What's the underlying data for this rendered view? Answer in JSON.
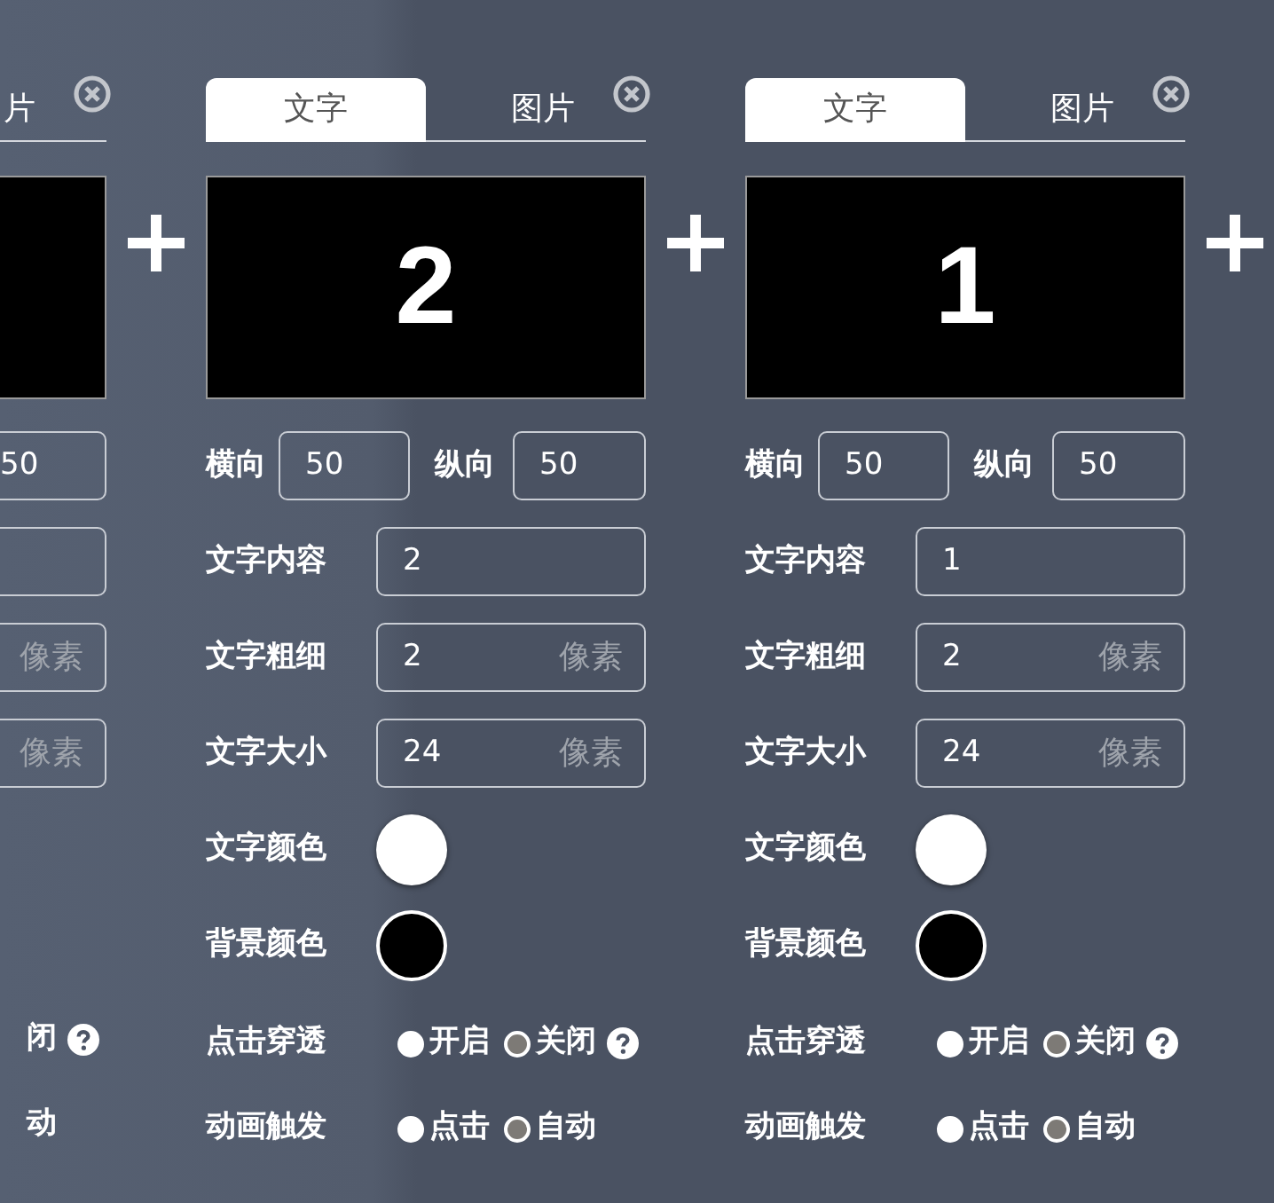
{
  "panels": [
    {
      "tabs": [
        {
          "label": "片",
          "selected": false
        }
      ],
      "closable": true,
      "position": {
        "y_value": "50"
      },
      "fields": [
        {
          "kind": "text"
        },
        {
          "kind": "number",
          "unit": "像素"
        },
        {
          "kind": "number",
          "unit": "像素"
        }
      ],
      "radios": [
        {
          "options": [
            {
              "label": "闭"
            }
          ],
          "help": true
        },
        {
          "options": [
            {
              "label": "动"
            }
          ],
          "help": false
        }
      ]
    },
    {
      "tabs": [
        {
          "label": "文字",
          "selected": true
        },
        {
          "label": "图片",
          "selected": false
        }
      ],
      "closable": true,
      "preview": {
        "text": "2"
      },
      "position": {
        "x_label": "横向",
        "x_value": "50",
        "y_label": "纵向",
        "y_value": "50"
      },
      "fields": [
        {
          "kind": "text",
          "label": "文字内容",
          "value": "2"
        },
        {
          "kind": "number",
          "label": "文字粗细",
          "value": "2",
          "unit": "像素"
        },
        {
          "kind": "number",
          "label": "文字大小",
          "value": "24",
          "unit": "像素"
        }
      ],
      "colors": [
        {
          "label": "文字颜色",
          "color": "#ffffff"
        },
        {
          "label": "背景颜色",
          "color": "#000000"
        }
      ],
      "radios": [
        {
          "label": "点击穿透",
          "options": [
            {
              "label": "开启",
              "selected": true
            },
            {
              "label": "关闭",
              "selected": false
            }
          ],
          "help": true
        },
        {
          "label": "动画触发",
          "options": [
            {
              "label": "点击",
              "selected": true
            },
            {
              "label": "自动",
              "selected": false
            }
          ],
          "help": false
        }
      ]
    },
    {
      "tabs": [
        {
          "label": "文字",
          "selected": true
        },
        {
          "label": "图片",
          "selected": false
        }
      ],
      "closable": true,
      "preview": {
        "text": "1"
      },
      "position": {
        "x_label": "横向",
        "x_value": "50",
        "y_label": "纵向",
        "y_value": "50"
      },
      "fields": [
        {
          "kind": "text",
          "label": "文字内容",
          "value": "1"
        },
        {
          "kind": "number",
          "label": "文字粗细",
          "value": "2",
          "unit": "像素"
        },
        {
          "kind": "number",
          "label": "文字大小",
          "value": "24",
          "unit": "像素"
        }
      ],
      "colors": [
        {
          "label": "文字颜色",
          "color": "#ffffff"
        },
        {
          "label": "背景颜色",
          "color": "#000000"
        }
      ],
      "radios": [
        {
          "label": "点击穿透",
          "options": [
            {
              "label": "开启",
              "selected": true
            },
            {
              "label": "关闭",
              "selected": false
            }
          ],
          "help": true
        },
        {
          "label": "动画触发",
          "options": [
            {
              "label": "点击",
              "selected": true
            },
            {
              "label": "自动",
              "selected": false
            }
          ],
          "help": false
        }
      ]
    }
  ]
}
